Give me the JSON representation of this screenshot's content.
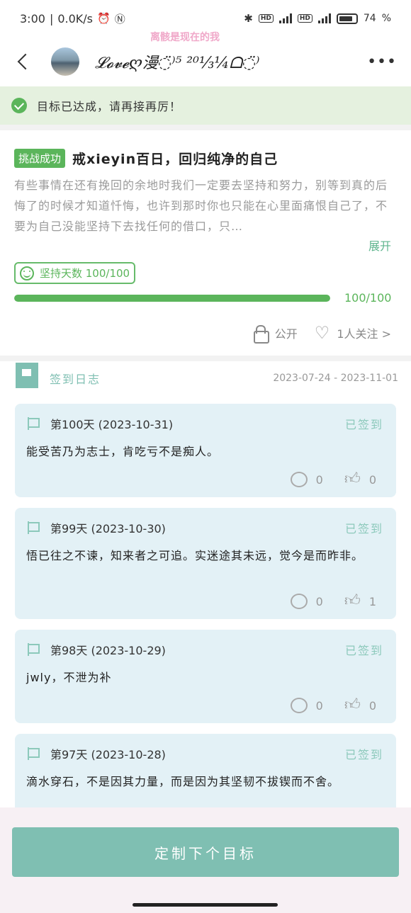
{
  "status_bar": {
    "time": "3:00",
    "speed": "0.0K/s",
    "battery": "74"
  },
  "header": {
    "profile_name": "𝓛𝓸𝓿𝓮ღ漫◌̈⁾⁵ ²⁰⅓¼ᗝ◌̈⁾",
    "watermark": "离骸是现在的我"
  },
  "banner": {
    "text": "目标已达成，请再接再厉！"
  },
  "challenge": {
    "badge": "挑战成功",
    "title": "戒xieyin百日，回归纯净的自己",
    "description": "有些事情在还有挽回的余地时我们一定要去坚持和努力，别等到真的后悔了的时候才知道忏悔，也许到那时你也只能在心里面痛恨自己了，不要为自己没能坚持下去找任何的借口，只…",
    "expand": "展开",
    "days_label": "坚持天数 100/100",
    "progress_percent": 100,
    "progress_label": "100/100",
    "visibility": "公开",
    "follow": "1人关注 >"
  },
  "log": {
    "title": "签到日志",
    "date_range": "2023-07-24 - 2023-11-01",
    "entries": [
      {
        "day": "第100天 (2023-10-31)",
        "status": "已签到",
        "text": "能受苦乃为志士，肯吃亏不是痴人。",
        "comments": "0",
        "likes": "0"
      },
      {
        "day": "第99天 (2023-10-30)",
        "status": "已签到",
        "text": "悟已往之不谏，知来者之可追。实迷途其未远，觉今是而昨非。",
        "comments": "0",
        "likes": "1"
      },
      {
        "day": "第98天 (2023-10-29)",
        "status": "已签到",
        "text": "jwly，不泄为补",
        "comments": "0",
        "likes": "0"
      },
      {
        "day": "第97天 (2023-10-28)",
        "status": "已签到",
        "text": "滴水穿石，不是因其力量，而是因为其坚韧不拔锲而不舍。",
        "comments": "",
        "likes": ""
      }
    ]
  },
  "bottom": {
    "next_button": "定制下个目标"
  },
  "colors": {
    "accent": "#5bb55b",
    "teal": "#7fbfb2",
    "entry_bg": "#e3f1f6",
    "banner_bg": "#e5f1df"
  }
}
